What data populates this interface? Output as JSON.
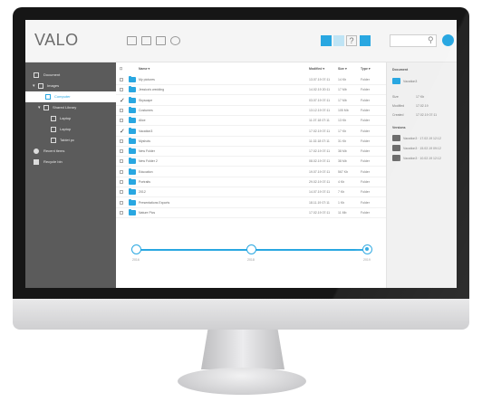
{
  "app": {
    "logo": "VALO"
  },
  "sidebar": {
    "items": [
      {
        "label": "Document",
        "icon": "hard-drive-icon"
      },
      {
        "label": "Images",
        "icon": "image-icon"
      },
      {
        "label": "Computer",
        "icon": "folder-icon"
      },
      {
        "label": "Shared Library",
        "icon": "shared-folder-icon"
      },
      {
        "label": "Laptop",
        "icon": "laptop-icon"
      },
      {
        "label": "Laptop",
        "icon": "laptop-icon"
      },
      {
        "label": "Tablet pc",
        "icon": "tablet-icon"
      },
      {
        "label": "Recent items",
        "icon": "clock-icon"
      },
      {
        "label": "Recycle bin",
        "icon": "trash-icon"
      }
    ]
  },
  "list": {
    "columns": {
      "name": "Name ▾",
      "modified": "Modified ▾",
      "size": "Size ▾",
      "type": "Type ▾"
    },
    "rows": [
      {
        "name": "My pictures",
        "modified": "13.07.19 07:11",
        "size": "14 Kb",
        "type": "Folder",
        "checked": false
      },
      {
        "name": "Jessica's wedding",
        "modified": "14.02.19 20:11",
        "size": "17 Mb",
        "type": "Folder",
        "checked": false
      },
      {
        "name": "Skyscape",
        "modified": "03.07.19 07:11",
        "size": "17 Mb",
        "type": "Folder",
        "checked": true
      },
      {
        "name": "Costumes",
        "modified": "13.12.19 07:11",
        "size": "105 Mb",
        "type": "Folder",
        "checked": false
      },
      {
        "name": "Alice",
        "modified": "11.07.18 07:11",
        "size": "13 Kb",
        "type": "Folder",
        "checked": false
      },
      {
        "name": "Vacation3",
        "modified": "17.02.19 07:11",
        "size": "17 Kb",
        "type": "Folder",
        "checked": true
      },
      {
        "name": "Myshots",
        "modified": "11.02.18 07:11",
        "size": "31 Kb",
        "type": "Folder",
        "checked": false
      },
      {
        "name": "New Folder",
        "modified": "17.02.19 07:11",
        "size": "38 Mb",
        "type": "Folder",
        "checked": false
      },
      {
        "name": "New Folder 2",
        "modified": "08.02.19 07:11",
        "size": "38 Mb",
        "type": "Folder",
        "checked": false
      },
      {
        "name": "Education",
        "modified": "19.07.19 07:11",
        "size": "567 Kb",
        "type": "Folder",
        "checked": false
      },
      {
        "name": "Portraits",
        "modified": "29.02.19 07:11",
        "size": "4 Kb",
        "type": "Folder",
        "checked": false
      },
      {
        "name": "2012",
        "modified": "14.07.19 07:11",
        "size": "7 Kb",
        "type": "Folder",
        "checked": false
      },
      {
        "name": "Presentations Exports",
        "modified": "18.11.19 07:11",
        "size": "1 Kb",
        "type": "Folder",
        "checked": false
      },
      {
        "name": "Nature Pics",
        "modified": "17.02.19 07:11",
        "size": "11 Mb",
        "type": "Folder",
        "checked": false
      }
    ]
  },
  "timeline": {
    "labels": [
      "2016",
      "2018",
      "2019"
    ],
    "active_index": 2
  },
  "detail": {
    "document_heading": "Document",
    "selected_name": "Vacation3",
    "props": [
      {
        "key": "Size",
        "value": "17 Kb"
      },
      {
        "key": "Modified",
        "value": "17.02.19"
      },
      {
        "key": "Created",
        "value": "17.02.19 07:11"
      }
    ],
    "versions_heading": "Versions",
    "versions": [
      "Vacation3 · 17.02.19 12:12",
      "Vacation3 · 15.02.19 09:12",
      "Vacation3 · 10.02.19 12:12"
    ]
  },
  "colors": {
    "accent": "#29a7e1",
    "sidebar": "#5b5b5b",
    "bezel": "#161616"
  }
}
